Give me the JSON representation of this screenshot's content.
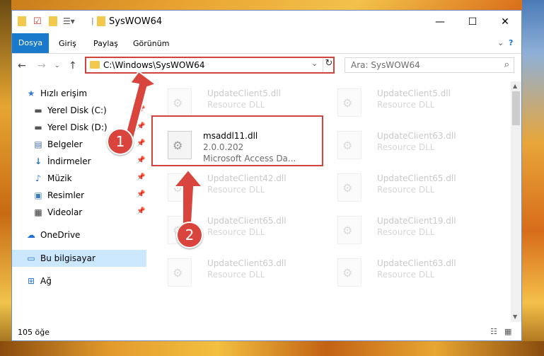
{
  "window": {
    "title": "SysWOW64"
  },
  "ribbon": {
    "tabs": [
      "Dosya",
      "Giriş",
      "Paylaş",
      "Görünüm"
    ]
  },
  "address": {
    "path": "C:\\Windows\\SysWOW64"
  },
  "search": {
    "placeholder": "Ara: SysWOW64"
  },
  "sidebar": {
    "items": [
      {
        "label": "Hızlı erişim",
        "icon": "star-icon"
      },
      {
        "label": "Yerel Disk (C:)",
        "icon": "drive-icon"
      },
      {
        "label": "Yerel Disk (D:)",
        "icon": "drive-icon"
      },
      {
        "label": "Belgeler",
        "icon": "documents-icon"
      },
      {
        "label": "İndirmeler",
        "icon": "download-icon"
      },
      {
        "label": "Müzik",
        "icon": "music-icon"
      },
      {
        "label": "Resimler",
        "icon": "pictures-icon"
      },
      {
        "label": "Videolar",
        "icon": "video-icon"
      },
      {
        "label": "OneDrive",
        "icon": "cloud-icon"
      },
      {
        "label": "Bu bilgisayar",
        "icon": "computer-icon"
      },
      {
        "label": "Ağ",
        "icon": "network-icon"
      }
    ]
  },
  "files": [
    {
      "name": "UpdateClient5.dll",
      "type": "Resource DLL"
    },
    {
      "name": "UpdateClient5.dll",
      "type": "Resource DLL"
    },
    {
      "name": "msaddl11.dll",
      "version": "2.0.0.202",
      "type": "Microsoft Access Da..."
    },
    {
      "name": "UpdateClient63.dll",
      "type": "Resource DLL"
    },
    {
      "name": "UpdateClient42.dll",
      "type": "Resource DLL"
    },
    {
      "name": "UpdateClient65.dll",
      "type": "Resource DLL"
    },
    {
      "name": "UpdateClient65.dll",
      "type": "Resource DLL"
    },
    {
      "name": "UpdateClient19.dll",
      "type": "Resource DLL"
    },
    {
      "name": "UpdateClient63.dll",
      "type": "Resource DLL"
    },
    {
      "name": "UpdateClient63.dll",
      "type": "Resource DLL"
    }
  ],
  "status": {
    "count": "105 öğe"
  },
  "callouts": [
    "1",
    "2"
  ],
  "colors": {
    "accent": "#1979ca",
    "highlight": "#d0443e",
    "selected": "#cce8ff"
  }
}
